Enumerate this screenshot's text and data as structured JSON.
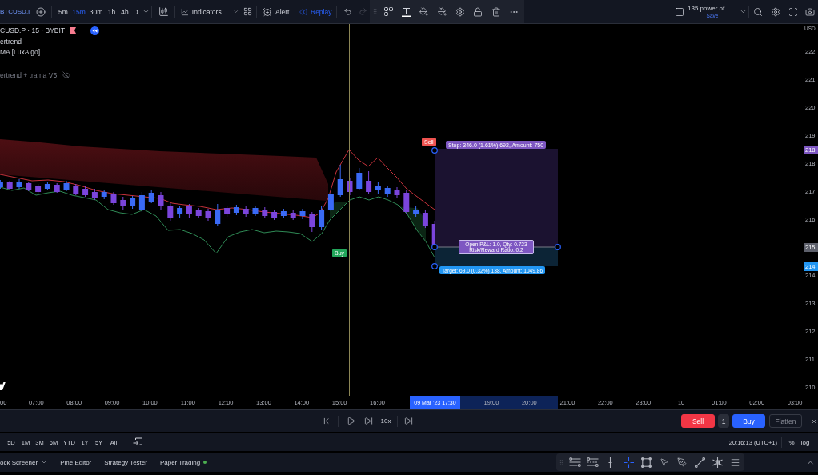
{
  "toolbar": {
    "symbol": "BTCUSD.I",
    "intervals": [
      {
        "label": "5m",
        "selected": false
      },
      {
        "label": "15m",
        "selected": true
      },
      {
        "label": "30m",
        "selected": false
      },
      {
        "label": "1h",
        "selected": false
      },
      {
        "label": "4h",
        "selected": false
      },
      {
        "label": "D",
        "selected": false
      }
    ],
    "indicators": "Indicators",
    "alert": "Alert",
    "replay": {
      "label": "Replay",
      "active": true
    },
    "redo": {
      "disabled": true
    },
    "layout": {
      "name": "135 power of ...",
      "status": "Save"
    }
  },
  "legend": {
    "symbol": "CUSD.P · 15 · BYBIT",
    "indicators": [
      "ertrend",
      "MA [LuxAlgo]"
    ],
    "strategy": {
      "name": "ertrend + trama V5",
      "hidden": true
    }
  },
  "position": {
    "side": "Sell",
    "stop": "Stop: 346.0 (1.61%) 692, Amount: 750",
    "pnl": [
      "Open P&L: 1.0, Qty: 0.723",
      "Risk/Reward Ratio: 0.2"
    ],
    "target": "Target: 69.0 (0.32%) 138, Amount: 1049.86"
  },
  "signal": {
    "label": "Buy"
  },
  "price_axis": {
    "unit": "USD",
    "ticks_upper": [
      "222",
      "221",
      "220",
      "219",
      "218",
      "217",
      "216"
    ],
    "ticks_lower": [
      "214",
      "213",
      "212",
      "211",
      "210"
    ],
    "badges": [
      {
        "label": "218",
        "kind": "stop"
      },
      {
        "label": "215",
        "kind": "last"
      },
      {
        "label": "214",
        "kind": "target"
      }
    ]
  },
  "time_axis": {
    "ticks_before": [
      "00",
      "07:00",
      "08:00",
      "09:00",
      "10:00",
      "11:00",
      "12:00",
      "13:00",
      "14:00",
      "15:00",
      "16:00"
    ],
    "range": {
      "cursor": "09 Mar '23 17:30",
      "ticks": [
        "19:00",
        "20:00"
      ]
    },
    "ticks_after": [
      "21:00",
      "22:00",
      "23:00",
      "10",
      "01:00",
      "02:00",
      "03:00"
    ]
  },
  "replay": {
    "speed": "10x"
  },
  "trading": {
    "sell": "Sell",
    "quantity": "1",
    "buy": "Buy",
    "flatten": {
      "label": "Flatten",
      "disabled": true
    }
  },
  "ranges": [
    {
      "label": "5D",
      "selected": false
    },
    {
      "label": "1M",
      "selected": false
    },
    {
      "label": "3M",
      "selected": false
    },
    {
      "label": "6M",
      "selected": false
    },
    {
      "label": "YTD",
      "selected": false
    },
    {
      "label": "1Y",
      "selected": false
    },
    {
      "label": "5Y",
      "selected": false
    },
    {
      "label": "All",
      "selected": false
    }
  ],
  "status": {
    "time": "20:16:13 (UTC+1)",
    "percent": "%",
    "log": "log"
  },
  "bottom_tabs": [
    {
      "label": "ock Screener",
      "menu": true,
      "connected": false
    },
    {
      "label": "Pine Editor",
      "menu": false,
      "connected": false
    },
    {
      "label": "Strategy Tester",
      "menu": false,
      "connected": false
    },
    {
      "label": "Paper Trading",
      "menu": false,
      "connected": true
    }
  ],
  "drawing_tools": [
    {
      "selected": false
    },
    {
      "selected": false
    },
    {
      "selected": false
    },
    {
      "selected": true
    },
    {
      "selected": false
    },
    {
      "selected": false
    },
    {
      "selected": false
    },
    {
      "selected": false
    },
    {
      "selected": false
    },
    {
      "selected": false
    }
  ]
}
